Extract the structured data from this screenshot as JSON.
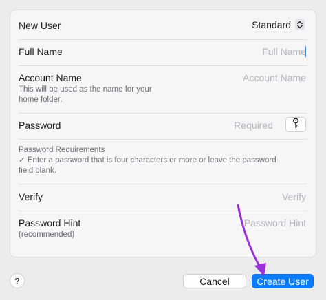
{
  "form": {
    "new_user": {
      "label": "New User",
      "value": "Standard"
    },
    "full_name": {
      "label": "Full Name",
      "placeholder": "Full Name"
    },
    "account_name": {
      "label": "Account Name",
      "placeholder": "Account Name",
      "note_line1": "This will be used as the name for your",
      "note_line2": "home folder."
    },
    "password": {
      "label": "Password",
      "placeholder": "Required"
    },
    "requirements": {
      "title": "Password Requirements",
      "line1": "✓ Enter a password that is four characters or more or leave the password",
      "line2": "field blank."
    },
    "verify": {
      "label": "Verify",
      "placeholder": "Verify"
    },
    "hint": {
      "label": "Password Hint",
      "sublabel": "(recommended)",
      "placeholder": "Password Hint"
    }
  },
  "footer": {
    "help_label": "?",
    "cancel_label": "Cancel",
    "create_label": "Create User"
  },
  "colors": {
    "accent": "#0a7cff",
    "annotation": "#9b30d9"
  },
  "icons": {
    "key": "key-icon",
    "stepper": "chevron-updown-icon"
  }
}
